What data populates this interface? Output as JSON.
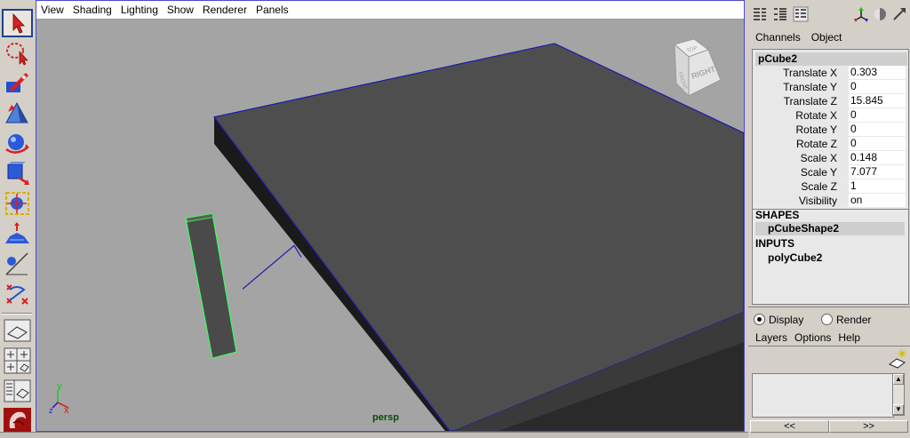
{
  "viewport": {
    "menu": [
      "View",
      "Shading",
      "Lighting",
      "Show",
      "Renderer",
      "Panels"
    ],
    "camera_label": "persp",
    "viewcube_face": "RIGHT",
    "viewcube_top": "TOP",
    "viewcube_front": "FRONT",
    "axis_y": "y",
    "axis_x": "x",
    "axis_z": "z"
  },
  "toolbox": {
    "tools": [
      "select-tool-icon",
      "lasso-tool-icon",
      "paint-select-tool-icon",
      "move-tool-icon",
      "rotate-tool-icon",
      "scale-tool-icon",
      "universal-manipulator-icon",
      "soft-modification-icon",
      "show-manipulator-icon",
      "last-tool-used-icon"
    ]
  },
  "channel_box": {
    "tabs": [
      "Channels",
      "Object"
    ],
    "object_name": "pCube2",
    "attributes": [
      {
        "label": "Translate X",
        "value": "0.303"
      },
      {
        "label": "Translate Y",
        "value": "0"
      },
      {
        "label": "Translate Z",
        "value": "15.845"
      },
      {
        "label": "Rotate X",
        "value": "0"
      },
      {
        "label": "Rotate Y",
        "value": "0"
      },
      {
        "label": "Rotate Z",
        "value": "0"
      },
      {
        "label": "Scale X",
        "value": "0.148"
      },
      {
        "label": "Scale Y",
        "value": "7.077"
      },
      {
        "label": "Scale Z",
        "value": "1"
      },
      {
        "label": "Visibility",
        "value": "on"
      }
    ],
    "shapes_header": "SHAPES",
    "shape_name": "pCubeShape2",
    "inputs_header": "INPUTS",
    "input_name": "polyCube2"
  },
  "layer_editor": {
    "radio_display": "Display",
    "radio_render": "Render",
    "menu": [
      "Layers",
      "Options",
      "Help"
    ],
    "nav_prev": "<<",
    "nav_next": ">>"
  }
}
